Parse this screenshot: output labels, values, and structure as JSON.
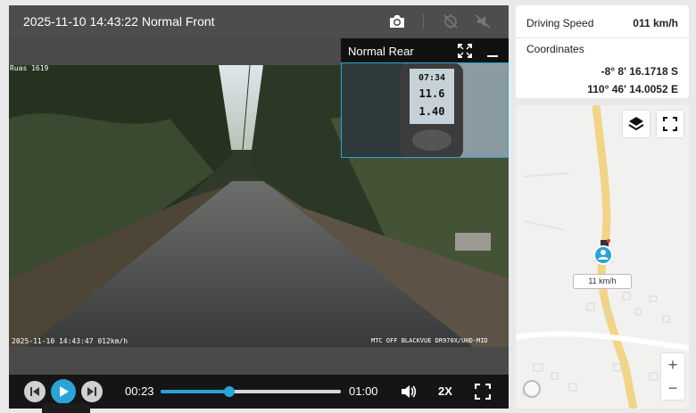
{
  "player": {
    "title": "2025-11-10 14:43:22 Normal Front",
    "icons": {
      "camera": "camera-icon",
      "gps_off": "no-gps-icon",
      "mic_off": "mute-icon"
    },
    "osd": {
      "top_left": "Ruas 1619",
      "bottom_left": "2025-11-10 14:43:47 012km/h",
      "bottom_right": "MTC OFF BLACKVUE DR970X/UHD-MID"
    },
    "rear": {
      "title": "Normal Rear",
      "device_readings": [
        "07:34",
        "11.6",
        "1.40"
      ]
    },
    "controls": {
      "current_time": "00:23",
      "total_time": "01:00",
      "progress": 0.383,
      "rate": "2X"
    }
  },
  "info": {
    "speed_label": "Driving Speed",
    "speed_value": "011 km/h",
    "coordinates_label": "Coordinates",
    "latitude": "-8° 8' 16.1718 S",
    "longitude": "110° 46' 14.0052 E"
  },
  "map": {
    "speed_tag": "11 km/h",
    "zoom_in": "+",
    "zoom_out": "−"
  },
  "colors": {
    "accent": "#2aa3d6",
    "road": "#f2d486",
    "controls_bg": "#151515"
  }
}
